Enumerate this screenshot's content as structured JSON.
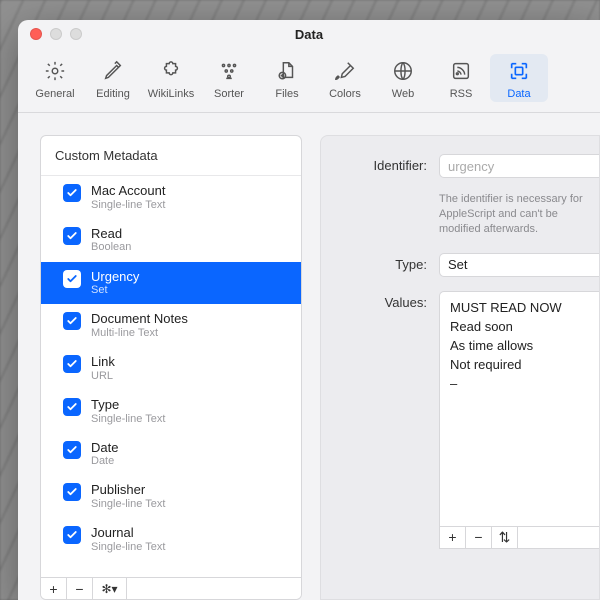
{
  "window": {
    "title": "Data"
  },
  "toolbar": [
    {
      "id": "general",
      "label": "General",
      "icon": "gear"
    },
    {
      "id": "editing",
      "label": "Editing",
      "icon": "pencil"
    },
    {
      "id": "wikilinks",
      "label": "WikiLinks",
      "icon": "puzzle"
    },
    {
      "id": "sorter",
      "label": "Sorter",
      "icon": "sorter"
    },
    {
      "id": "files",
      "label": "Files",
      "icon": "files"
    },
    {
      "id": "colors",
      "label": "Colors",
      "icon": "brush"
    },
    {
      "id": "web",
      "label": "Web",
      "icon": "globe"
    },
    {
      "id": "rss",
      "label": "RSS",
      "icon": "rss"
    },
    {
      "id": "data",
      "label": "Data",
      "icon": "data",
      "active": true
    }
  ],
  "left": {
    "header": "Custom Metadata",
    "items": [
      {
        "name": "Mac Account",
        "sub": "Single-line Text",
        "checked": true,
        "selected": false
      },
      {
        "name": "Read",
        "sub": "Boolean",
        "checked": true,
        "selected": false
      },
      {
        "name": "Urgency",
        "sub": "Set",
        "checked": true,
        "selected": true
      },
      {
        "name": "Document Notes",
        "sub": "Multi-line Text",
        "checked": true,
        "selected": false
      },
      {
        "name": "Link",
        "sub": "URL",
        "checked": true,
        "selected": false
      },
      {
        "name": "Type",
        "sub": "Single-line Text",
        "checked": true,
        "selected": false
      },
      {
        "name": "Date",
        "sub": "Date",
        "checked": true,
        "selected": false
      },
      {
        "name": "Publisher",
        "sub": "Single-line Text",
        "checked": true,
        "selected": false
      },
      {
        "name": "Journal",
        "sub": "Single-line Text",
        "checked": true,
        "selected": false
      }
    ]
  },
  "detail": {
    "identifier_label": "Identifier:",
    "identifier_value": "urgency",
    "hint": "The identifier is necessary for AppleScript and can't be modified afterwards.",
    "type_label": "Type:",
    "type_value": "Set",
    "values_label": "Values:",
    "values": [
      "MUST READ NOW",
      "Read soon",
      "As time allows",
      "Not required",
      "–"
    ]
  },
  "glyphs": {
    "plus": "+",
    "minus": "−",
    "gear": "✻▾",
    "updown": "⇅"
  }
}
